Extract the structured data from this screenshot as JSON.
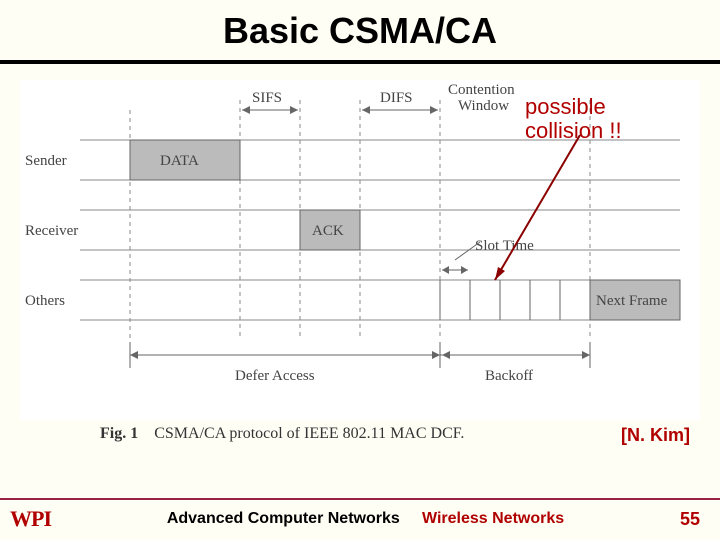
{
  "title": "Basic CSMA/CA",
  "annotation": {
    "line1": "possible",
    "line2": "collision !!"
  },
  "diagram": {
    "rows": {
      "sender": "Sender",
      "receiver": "Receiver",
      "others": "Others"
    },
    "intervals": {
      "sifs": "SIFS",
      "difs": "DIFS",
      "cw": "Contention",
      "cw2": "Window"
    },
    "blocks": {
      "data": "DATA",
      "ack": "ACK",
      "next": "Next Frame"
    },
    "slot": "Slot Time",
    "defer": "Defer Access",
    "backoff": "Backoff"
  },
  "caption": {
    "figlabel": "Fig. 1",
    "text": "CSMA/CA protocol of IEEE 802.11 MAC DCF."
  },
  "citation": "[N.  Kim]",
  "footer": {
    "logo": "WPI",
    "course": "Advanced Computer Networks",
    "topic": "Wireless Networks",
    "page": "55"
  }
}
